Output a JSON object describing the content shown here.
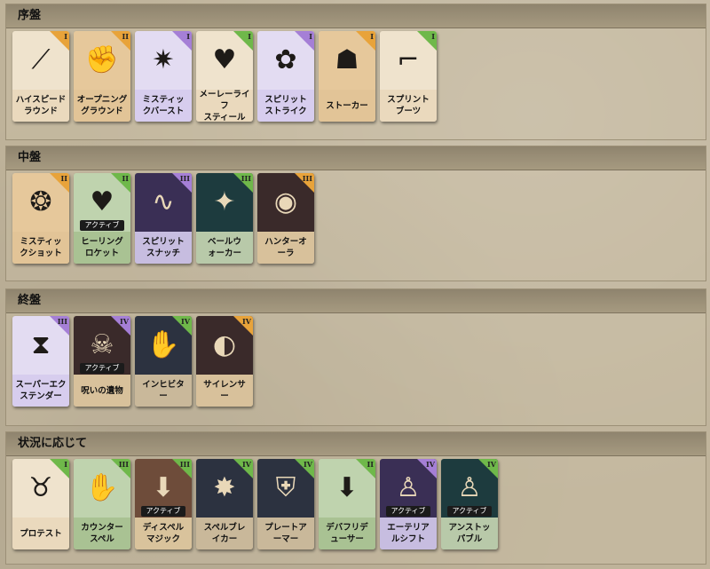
{
  "sections": [
    {
      "title": "序盤",
      "cards": [
        {
          "label": "ハイスピード\nラウンド",
          "tier": "I",
          "tier_color": "#e8a33a",
          "scheme": "c-beige",
          "glyph": "⟋",
          "active": false
        },
        {
          "label": "オープニング\nグラウンド",
          "tier": "II",
          "tier_color": "#e8a33a",
          "scheme": "c-tan",
          "glyph": "✊",
          "active": false
        },
        {
          "label": "ミスティッ\nクバースト",
          "tier": "I",
          "tier_color": "#a57fd6",
          "scheme": "c-lav",
          "glyph": "✷",
          "active": false
        },
        {
          "label": "メーレーライフ\nスティール",
          "tier": "I",
          "tier_color": "#6fb84a",
          "scheme": "c-beige",
          "glyph": "♥",
          "active": false
        },
        {
          "label": "スピリット\nストライク",
          "tier": "I",
          "tier_color": "#a57fd6",
          "scheme": "c-lav",
          "glyph": "✿",
          "active": false
        },
        {
          "label": "ストーカー",
          "tier": "I",
          "tier_color": "#e8a33a",
          "scheme": "c-tan",
          "glyph": "☗",
          "active": false
        },
        {
          "label": "スプリント\nブーツ",
          "tier": "I",
          "tier_color": "#6fb84a",
          "scheme": "c-beige",
          "glyph": "⌐",
          "active": false
        }
      ]
    },
    {
      "title": "中盤",
      "cards": [
        {
          "label": "ミスティッ\nクショット",
          "tier": "II",
          "tier_color": "#e8a33a",
          "scheme": "c-tan",
          "glyph": "❂",
          "active": false
        },
        {
          "label": "ヒーリング\nロケット",
          "tier": "II",
          "tier_color": "#6fb84a",
          "scheme": "c-green",
          "glyph": "♥",
          "active": true
        },
        {
          "label": "スピリット\nスナッチ",
          "tier": "III",
          "tier_color": "#a57fd6",
          "scheme": "c-purple",
          "glyph": "∿",
          "active": false
        },
        {
          "label": "ベールウ\nォーカー",
          "tier": "III",
          "tier_color": "#6fb84a",
          "scheme": "c-teal",
          "glyph": "✦",
          "active": false
        },
        {
          "label": "ハンターオ\nーラ",
          "tier": "III",
          "tier_color": "#e8a33a",
          "scheme": "c-red",
          "glyph": "◉",
          "active": false
        }
      ]
    },
    {
      "title": "終盤",
      "cards": [
        {
          "label": "スーパーエク\nステンダー",
          "tier": "III",
          "tier_color": "#a57fd6",
          "scheme": "c-lav",
          "glyph": "⧗",
          "active": false
        },
        {
          "label": "呪いの遺物",
          "tier": "IV",
          "tier_color": "#a57fd6",
          "scheme": "c-red",
          "glyph": "☠",
          "active": true
        },
        {
          "label": "インヒビタ\nー",
          "tier": "IV",
          "tier_color": "#6fb84a",
          "scheme": "c-dark",
          "glyph": "✋",
          "active": false
        },
        {
          "label": "サイレンサ\nー",
          "tier": "IV",
          "tier_color": "#e8a33a",
          "scheme": "c-red",
          "glyph": "◐",
          "active": false
        }
      ]
    },
    {
      "title": "状況に応じて",
      "cards": [
        {
          "label": "プロテスト",
          "tier": "I",
          "tier_color": "#6fb84a",
          "scheme": "c-beige",
          "glyph": "♉",
          "active": false
        },
        {
          "label": "カウンター\nスペル",
          "tier": "III",
          "tier_color": "#6fb84a",
          "scheme": "c-green",
          "glyph": "✋",
          "active": false
        },
        {
          "label": "ディスペル\nマジック",
          "tier": "III",
          "tier_color": "#6fb84a",
          "scheme": "c-brown",
          "glyph": "⬇",
          "active": true
        },
        {
          "label": "スペルブレ\nイカー",
          "tier": "IV",
          "tier_color": "#6fb84a",
          "scheme": "c-dark",
          "glyph": "✸",
          "active": false
        },
        {
          "label": "プレートア\nーマー",
          "tier": "IV",
          "tier_color": "#6fb84a",
          "scheme": "c-dark",
          "glyph": "⛨",
          "active": false
        },
        {
          "label": "デバフリデ\nューサー",
          "tier": "II",
          "tier_color": "#6fb84a",
          "scheme": "c-green",
          "glyph": "⬇",
          "active": false
        },
        {
          "label": "エーテリア\nルシフト",
          "tier": "IV",
          "tier_color": "#a57fd6",
          "scheme": "c-purple",
          "glyph": "♙",
          "active": true
        },
        {
          "label": "アンストッ\nパブル",
          "tier": "IV",
          "tier_color": "#6fb84a",
          "scheme": "c-teal",
          "glyph": "♙",
          "active": true
        }
      ]
    }
  ],
  "active_label": "アクティブ"
}
